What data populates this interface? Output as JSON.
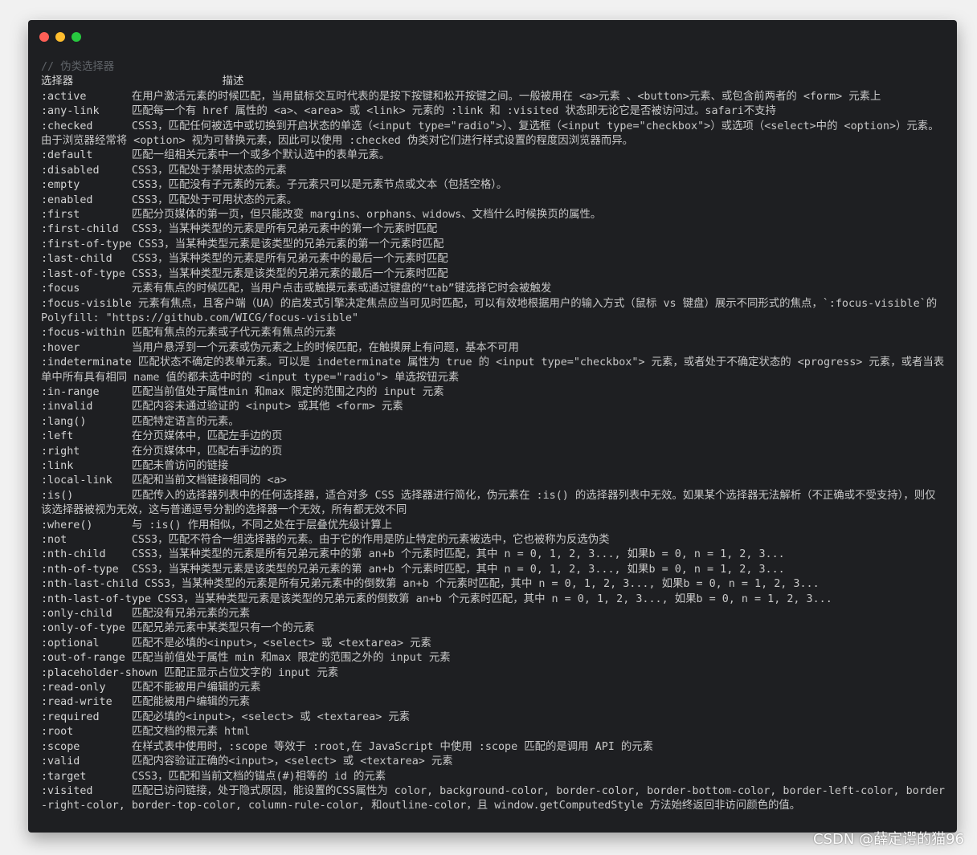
{
  "window": {
    "controls": [
      {
        "name": "close",
        "color": "#ff5f56"
      },
      {
        "name": "minimize",
        "color": "#ffbd2e"
      },
      {
        "name": "zoom",
        "color": "#27c93f"
      }
    ],
    "comment": "// 伪类选择器",
    "header": {
      "selector": "选择器",
      "spacer": "                       ",
      "desc": "描述"
    }
  },
  "rows": [
    [
      ":active      ",
      " 在用户激活元素的时候匹配，当用鼠标交互时代表的是按下按键和松开按键之间。一般被用在 <a>元素 、<button>元素、或包含前两者的 <form> 元素上"
    ],
    [
      ":any-link    ",
      " 匹配每一个有 href 属性的 <a>、<area> 或 <link> 元素的 :link 和 :visited 状态即无论它是否被访问过。safari不支持"
    ],
    [
      ":checked     ",
      " CSS3，匹配任何被选中或切换到开启状态的单选（<input type=\"radio\">）、复选框（<input type=\"checkbox\">）或选项（<select>中的 <option>）元素。由于浏览器经常将 <option> 视为可替换元素，因此可以使用 :checked 伪类对它们进行样式设置的程度因浏览器而异。"
    ],
    [
      ":default     ",
      " 匹配一组相关元素中一个或多个默认选中的表单元素。"
    ],
    [
      ":disabled    ",
      " CSS3，匹配处于禁用状态的元素"
    ],
    [
      ":empty       ",
      " CSS3，匹配没有子元素的元素。子元素只可以是元素节点或文本（包括空格）。"
    ],
    [
      ":enabled     ",
      " CSS3，匹配处于可用状态的元素。"
    ],
    [
      ":first       ",
      " 匹配分页媒体的第一页，但只能改变 margins、orphans、widows、文档什么时候换页的属性。"
    ],
    [
      ":first-child ",
      " CSS3，当某种类型的元素是所有兄弟元素中的第一个元素时匹配"
    ],
    [
      ":first-of-type",
      " CSS3，当某种类型元素是该类型的兄弟元素的第一个元素时匹配"
    ],
    [
      ":last-child  ",
      " CSS3，当某种类型的元素是所有兄弟元素中的最后一个元素时匹配"
    ],
    [
      ":last-of-type",
      " CSS3，当某种类型元素是该类型的兄弟元素的最后一个元素时匹配"
    ],
    [
      ":focus       ",
      " 元素有焦点的时候匹配，当用户点击或触摸元素或通过键盘的“tab”键选择它时会被触发"
    ],
    [
      ":focus-visible",
      " 元素有焦点，且客户端（UA）的启发式引擎决定焦点应当可见时匹配，可以有效地根据用户的输入方式（鼠标 vs 键盘）展示不同形式的焦点，`:focus-visible`的 Polyfill: \"https://github.com/WICG/focus-visible\""
    ],
    [
      ":focus-within",
      " 匹配有焦点的元素或子代元素有焦点的元素"
    ],
    [
      ":hover       ",
      " 当用户悬浮到一个元素或伪元素之上的时候匹配，在触摸屏上有问题，基本不可用"
    ],
    [
      ":indeterminate",
      " 匹配状态不确定的表单元素。可以是 indeterminate 属性为 true 的 <input type=\"checkbox\"> 元素，或者处于不确定状态的 <progress> 元素，或者当表单中所有具有相同 name 值的都未选中时的 <input type=\"radio\"> 单选按钮元素"
    ],
    [
      ":in-range    ",
      " 匹配当前值处于属性min 和max 限定的范围之内的 input 元素"
    ],
    [
      ":invalid     ",
      " 匹配内容未通过验证的 <input> 或其他 <form> 元素"
    ],
    [
      ":lang()      ",
      " 匹配特定语言的元素。"
    ],
    [
      ":left        ",
      " 在分页媒体中，匹配左手边的页"
    ],
    [
      ":right       ",
      " 在分页媒体中，匹配右手边的页"
    ],
    [
      ":link        ",
      " 匹配未曾访问的链接"
    ],
    [
      ":local-link  ",
      " 匹配和当前文档链接相同的 <a>"
    ],
    [
      ":is()        ",
      " 匹配传入的选择器列表中的任何选择器，适合对多 CSS 选择器进行简化，伪元素在 :is() 的选择器列表中无效。如果某个选择器无法解析（不正确或不受支持），则仅该选择器被视为无效，这与普通逗号分割的选择器一个无效，所有都无效不同"
    ],
    [
      ":where()     ",
      "  与 :is() 作用相似，不同之处在于层叠优先级计算上"
    ],
    [
      ":not         ",
      " CSS3，匹配不符合一组选择器的元素。由于它的作用是防止特定的元素被选中，它也被称为反选伪类"
    ],
    [
      ":nth-child   ",
      " CSS3，当某种类型的元素是所有兄弟元素中的第 an+b 个元素时匹配，其中 n = 0, 1, 2, 3..., 如果b = 0, n = 1, 2, 3..."
    ],
    [
      ":nth-of-type ",
      " CSS3，当某种类型元素是该类型的兄弟元素的第 an+b 个元素时匹配，其中 n = 0, 1, 2, 3..., 如果b = 0, n = 1, 2, 3..."
    ],
    [
      ":nth-last-child",
      " CSS3，当某种类型的元素是所有兄弟元素中的倒数第 an+b 个元素时匹配，其中 n = 0, 1, 2, 3..., 如果b = 0, n = 1, 2, 3..."
    ],
    [
      ":nth-last-of-type",
      " CSS3，当某种类型元素是该类型的兄弟元素的倒数第 an+b 个元素时匹配，其中 n = 0, 1, 2, 3..., 如果b = 0, n = 1, 2, 3..."
    ],
    [
      ":only-child  ",
      " 匹配没有兄弟元素的元素"
    ],
    [
      ":only-of-type",
      " 匹配兄弟元素中某类型只有一个的元素"
    ],
    [
      ":optional    ",
      " 匹配不是必填的<input>，<select> 或 <textarea> 元素"
    ],
    [
      ":out-of-range",
      " 匹配当前值处于属性 min 和max 限定的范围之外的 input 元素"
    ],
    [
      ":placeholder-shown",
      " 匹配正显示占位文字的 input 元素"
    ],
    [
      ":read-only   ",
      " 匹配不能被用户编辑的元素"
    ],
    [
      ":read-write  ",
      " 匹配能被用户编辑的元素"
    ],
    [
      ":required    ",
      " 匹配必填的<input>，<select> 或 <textarea> 元素"
    ],
    [
      ":root        ",
      " 匹配文档的根元素 html"
    ],
    [
      ":scope       ",
      " 在样式表中使用时，:scope 等效于 :root,在 JavaScript 中使用 :scope 匹配的是调用 API 的元素"
    ],
    [
      ":valid       ",
      " 匹配内容验证正确的<input>，<select> 或 <textarea> 元素"
    ],
    [
      ":target      ",
      " CSS3，匹配和当前文档的锚点(#)相等的 id 的元素"
    ],
    [
      ":visited     ",
      " 匹配已访问链接，处于隐式原因，能设置的CSS属性为 color, background-color, border-color, border-bottom-color, border-left-color, border-right-color, border-top-color, column-rule-color, 和outline-color，且 window.getComputedStyle 方法始终返回非访问颜色的值。"
    ]
  ],
  "watermark": "CSDN @薛定谔的猫96"
}
